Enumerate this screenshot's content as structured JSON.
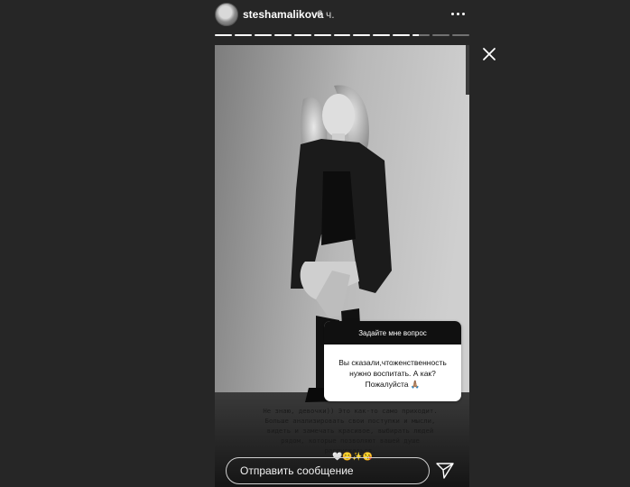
{
  "header": {
    "username": "steshamalikova",
    "time": "6 ч."
  },
  "progress": {
    "segment_fill": [
      1,
      1,
      1,
      1,
      1,
      1,
      1,
      1,
      1,
      1,
      0.35,
      0,
      0
    ]
  },
  "story": {
    "question_sticker": {
      "title": "Задайте мне вопрос",
      "text": "Вы сказали,чтоженственность нужно воспитать. А как? Пожалуйста 🙏🏽"
    },
    "answer_text": "Не знаю, девочки)) Это как-то само приходит.\nБольше анализировать свои поступки и мысли,\nвидеть и замечать красивое, выбирать людей\nрядом, которые позволяют вашей душе\nраспускаться.",
    "emojis": "🤍😊✨😘"
  },
  "footer": {
    "message_placeholder": "Отправить сообщение"
  }
}
